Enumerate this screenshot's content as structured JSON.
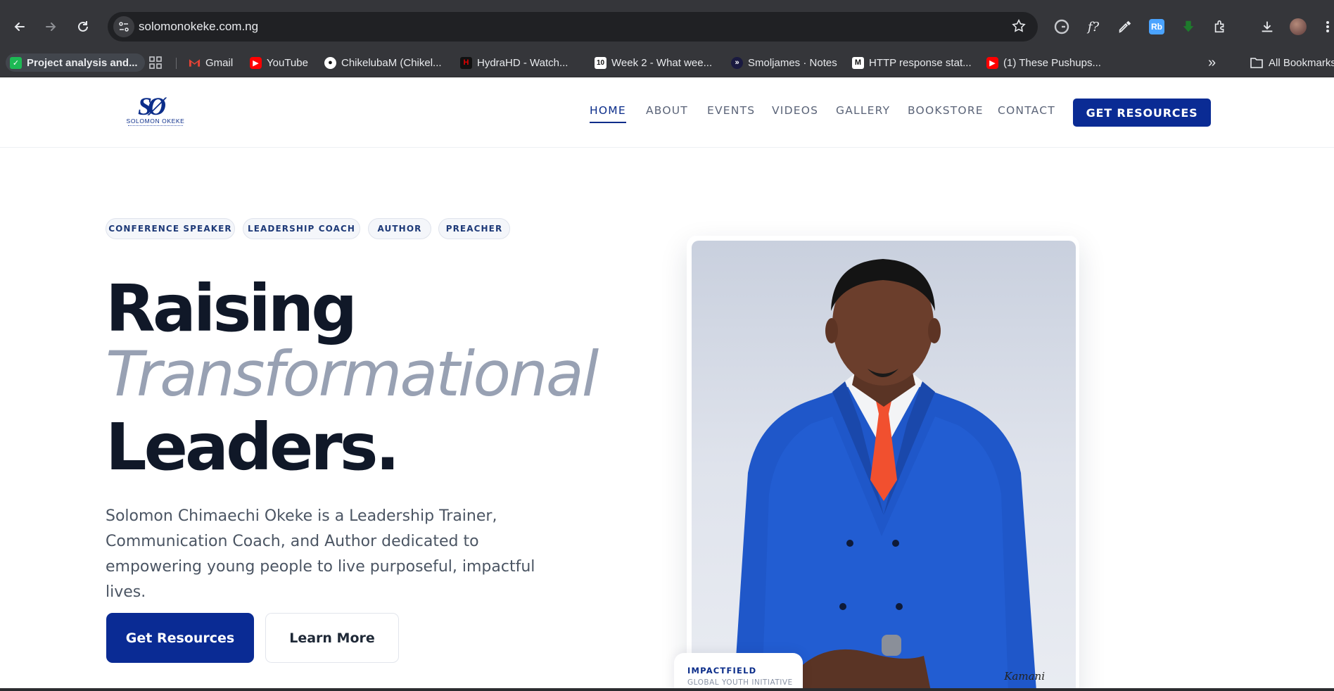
{
  "browser": {
    "url": "solomonokeke.com.ng",
    "bookmarks": [
      {
        "label": "Project analysis and...",
        "icon": "checkbox-icon",
        "color": "#1db954"
      },
      {
        "label": "Gmail",
        "icon": "gmail-icon",
        "color": "#ea4335"
      },
      {
        "label": "YouTube",
        "icon": "youtube-icon",
        "color": "#ff0000"
      },
      {
        "label": "ChikelubaM (Chikel...",
        "icon": "github-icon",
        "color": "#ffffff"
      },
      {
        "label": "HydraHD - Watch...",
        "icon": "hydra-icon",
        "color": "#e00000"
      },
      {
        "label": "Week 2 - What wee...",
        "icon": "calendar-icon",
        "color": "#ffffff"
      },
      {
        "label": "Smoljames · Notes",
        "icon": "smoljames-icon",
        "color": "#1a1a40"
      },
      {
        "label": "HTTP response stat...",
        "icon": "mdn-icon",
        "color": "#ffffff"
      },
      {
        "label": "(1) These Pushups...",
        "icon": "youtube-icon",
        "color": "#ff0000"
      }
    ],
    "all_bookmarks": "All Bookmarks",
    "calendar_day": "10"
  },
  "site": {
    "logo_mark": "SØ",
    "logo_name": "SOLOMON OKEKE",
    "nav": [
      {
        "label": "HOME",
        "active": true
      },
      {
        "label": "ABOUT"
      },
      {
        "label": "EVENTS"
      },
      {
        "label": "VIDEOS"
      },
      {
        "label": "GALLERY"
      },
      {
        "label": "BOOKSTORE"
      },
      {
        "label": "CONTACT"
      }
    ],
    "header_cta": "GET RESOURCES",
    "accent": "#0a2b94"
  },
  "hero": {
    "tags": [
      "CONFERENCE SPEAKER",
      "LEADERSHIP COACH",
      "AUTHOR",
      "PREACHER"
    ],
    "line1": "Raising",
    "line2": "Transformational",
    "line3": "Leaders.",
    "lead": "Solomon Chimaechi Okeke is a Leadership Trainer, Communication Coach, and Author dedicated to empowering young people to live purposeful, impactful lives.",
    "btn_primary": "Get Resources",
    "btn_secondary": "Learn More",
    "photo_signature": "Kamani",
    "badge_title": "IMPACTFIELD",
    "badge_sub": "GLOBAL YOUTH INITIATIVE"
  }
}
